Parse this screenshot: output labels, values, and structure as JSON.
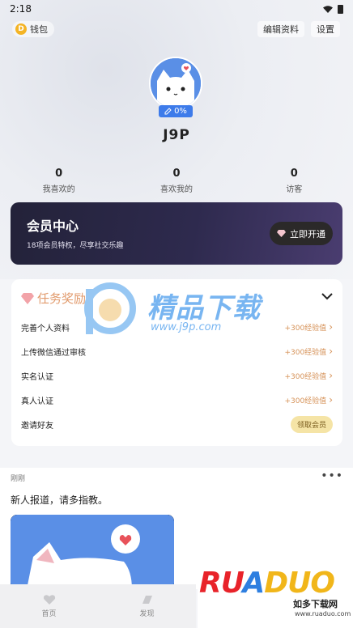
{
  "status_bar": {
    "time": "2:18"
  },
  "header": {
    "wallet_label": "钱包",
    "wallet_coin_letter": "D",
    "edit_profile_label": "编辑资料",
    "settings_label": "设置"
  },
  "profile": {
    "username": "J9P",
    "completion": "0%"
  },
  "stats": [
    {
      "value": "0",
      "label": "我喜欢的"
    },
    {
      "value": "0",
      "label": "喜欢我的"
    },
    {
      "value": "0",
      "label": "访客"
    }
  ],
  "vip": {
    "title": "会员中心",
    "subtitle": "18项会员特权，尽享社交乐趣",
    "button_label": "立即开通"
  },
  "tasks": {
    "title": "任务奖励",
    "items": [
      {
        "label": "完善个人资料",
        "reward": "+300经验值"
      },
      {
        "label": "上传微信通过审核",
        "reward": "+300经验值"
      },
      {
        "label": "实名认证",
        "reward": "+300经验值"
      },
      {
        "label": "真人认证",
        "reward": "+300经验值"
      },
      {
        "label": "邀请好友",
        "action": "领取会员"
      }
    ]
  },
  "watermark": {
    "text": "精品下载",
    "url": "www.j9p.com"
  },
  "feed": {
    "time": "刚刚",
    "text": "新人报道，请多指教。"
  },
  "bottom_nav": [
    {
      "label": "首页"
    },
    {
      "label": "发现"
    }
  ],
  "ruanduo_watermark": {
    "logo_r": "RU",
    "logo_a": "A",
    "logo_rest": "DUO",
    "cn": "如多下载网",
    "url": "www.ruaduo.com"
  },
  "colors": {
    "accent_blue": "#3d7bea",
    "reward_orange": "#d69258",
    "vip_dark": "#2e2a4e",
    "claim_yellow": "#f5e4a6"
  }
}
